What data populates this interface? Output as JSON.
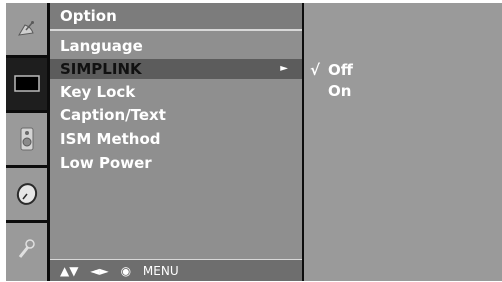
{
  "menu": {
    "title": "Option",
    "items": [
      {
        "label": "Language"
      },
      {
        "label": "SIMPLINK",
        "selected": true
      },
      {
        "label": "Key Lock"
      },
      {
        "label": "Caption/Text"
      },
      {
        "label": "ISM Method"
      },
      {
        "label": "Low Power"
      }
    ]
  },
  "footer": {
    "nav_updown": "▲▼",
    "nav_leftright": "◄►",
    "ok": "◉",
    "menu_label": "MENU"
  },
  "submenu": {
    "check_mark": "√",
    "options": [
      {
        "label": "Off",
        "checked": true
      },
      {
        "label": "On",
        "checked": false
      }
    ]
  },
  "icons": [
    "satellite-dish-icon",
    "screen-icon",
    "speaker-icon",
    "clock-icon",
    "option-icon"
  ],
  "colors": {
    "menu_bg": "#8f8f8f",
    "selected_bg": "#5c5c5c",
    "title_bg": "#7c7c7c"
  }
}
